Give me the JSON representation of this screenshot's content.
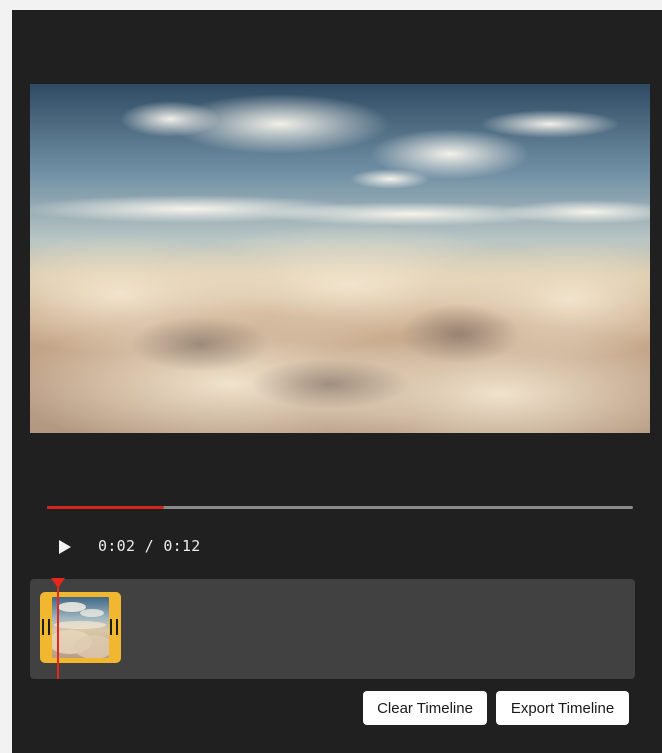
{
  "player": {
    "current_time": "0:02",
    "duration": "0:12",
    "time_display": "0:02 / 0:12",
    "progress_fraction": 0.2,
    "play_icon": "play-icon",
    "video_content": "aerial view above sunlit clouds and blue sky"
  },
  "timeline": {
    "clips": [
      {
        "thumbnail": "clouds-thumbnail",
        "color": "#f0b72f"
      }
    ],
    "playhead_color": "#e8261c"
  },
  "actions": {
    "clear_label": "Clear Timeline",
    "export_label": "Export Timeline"
  },
  "colors": {
    "background": "#202020",
    "timeline_track": "#414141",
    "progress_fill": "#d4261e",
    "progress_track": "#8a8a8a"
  }
}
